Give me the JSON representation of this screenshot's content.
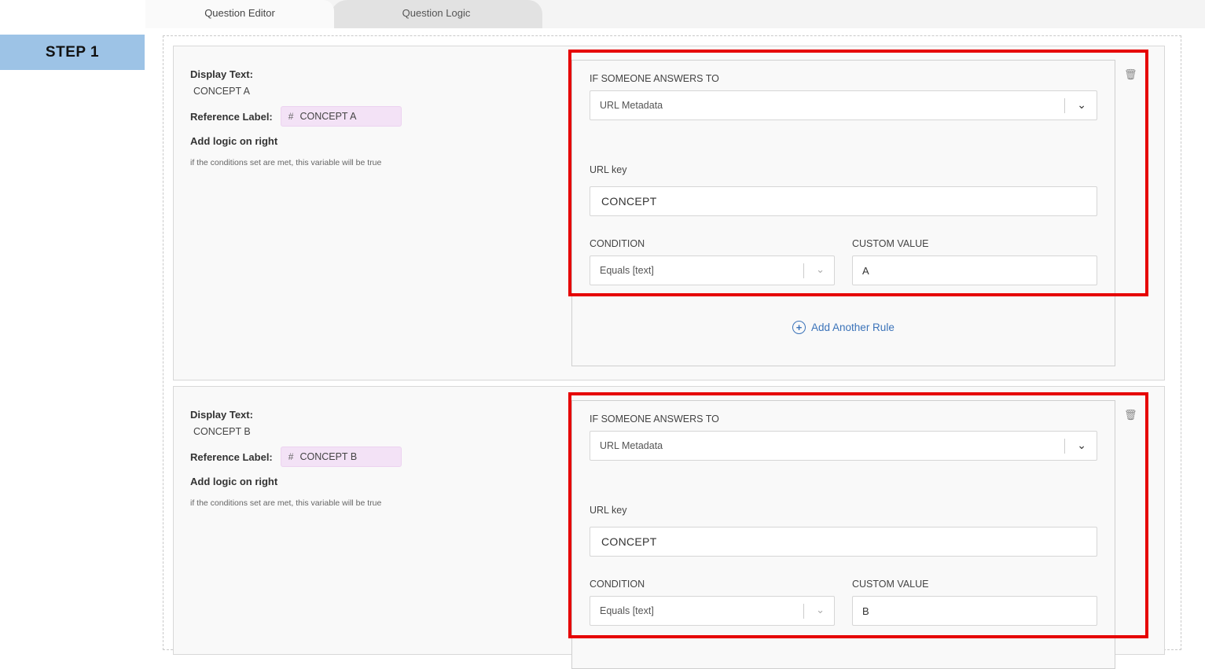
{
  "tabs": [
    {
      "label": "Question Editor",
      "active": true
    },
    {
      "label": "Question Logic",
      "active": false
    }
  ],
  "step_label": "STEP 1",
  "cards": [
    {
      "display_text_label": "Display Text:",
      "display_text_value": "CONCEPT A",
      "reference_label": "Reference Label:",
      "reference_hash": "#",
      "reference_value": "CONCEPT A",
      "add_logic": "Add logic on right",
      "hint": "if the conditions set are met, this variable will be true",
      "rule": {
        "if_label": "IF SOMEONE ANSWERS TO",
        "source_value": "URL Metadata",
        "url_key_label": "URL key",
        "url_key_value": "CONCEPT",
        "condition_label": "CONDITION",
        "condition_value": "Equals [text]",
        "custom_value_label": "CUSTOM VALUE",
        "custom_value": "A"
      },
      "add_rule": "Add Another Rule"
    },
    {
      "display_text_label": "Display Text:",
      "display_text_value": "CONCEPT B",
      "reference_label": "Reference Label:",
      "reference_hash": "#",
      "reference_value": "CONCEPT B",
      "add_logic": "Add logic on right",
      "hint": "if the conditions set are met, this variable will be true",
      "rule": {
        "if_label": "IF SOMEONE ANSWERS TO",
        "source_value": "URL Metadata",
        "url_key_label": "URL key",
        "url_key_value": "CONCEPT",
        "condition_label": "CONDITION",
        "condition_value": "Equals [text]",
        "custom_value_label": "CUSTOM VALUE",
        "custom_value": "B"
      }
    }
  ],
  "icons": {
    "trash": "trash-icon",
    "chevron": "chevron-down-icon",
    "plus": "plus-circle-icon"
  },
  "colors": {
    "highlight": "#e60000",
    "step_bg": "#9dc3e6",
    "link": "#3b73b9",
    "chip_bg": "#f3e2f6"
  }
}
